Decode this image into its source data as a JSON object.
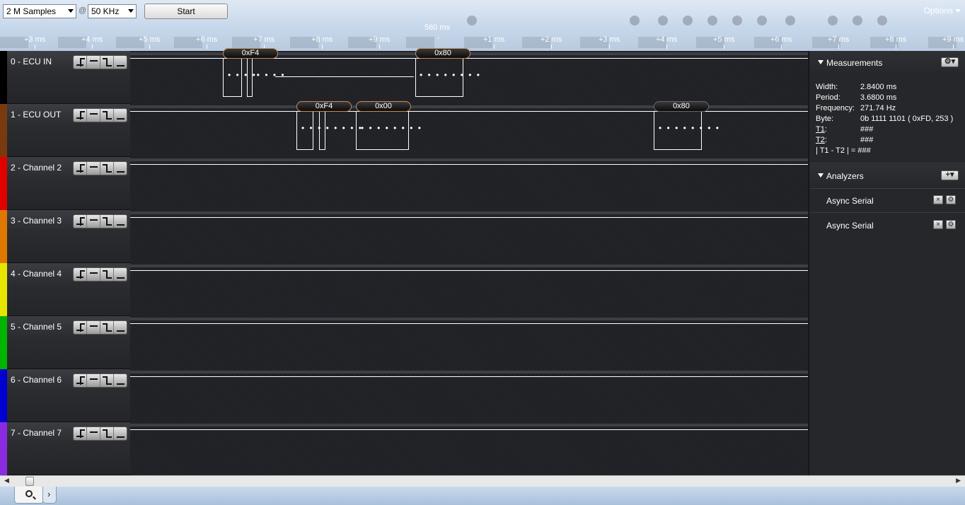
{
  "toolbar": {
    "samples_value": "2 M Samples",
    "at": "@",
    "rate_value": "50 KHz",
    "start_label": "Start",
    "options_label": "Options"
  },
  "timeline": {
    "cursor_time": "560 ms",
    "ticks": [
      "+3 ms",
      "+4 ms",
      "+5 ms",
      "+6 ms",
      "+7 ms",
      "+8 ms",
      "+9 ms",
      "+1 ms",
      "+2 ms",
      "+3 ms",
      "+4 ms",
      "+5 ms",
      "+6 ms",
      "+7 ms",
      "+8 ms",
      "+9 ms"
    ]
  },
  "channels": [
    {
      "name": "0 - ECU IN",
      "color": "#000000"
    },
    {
      "name": "1 - ECU OUT",
      "color": "#7a3a10"
    },
    {
      "name": "2 - Channel 2",
      "color": "#e00000"
    },
    {
      "name": "3 - Channel 3",
      "color": "#e07800"
    },
    {
      "name": "4 - Channel 4",
      "color": "#e6e600"
    },
    {
      "name": "5 - Channel 5",
      "color": "#00b400"
    },
    {
      "name": "6 - Channel 6",
      "color": "#0000d0"
    },
    {
      "name": "7 - Channel 7",
      "color": "#8a2be2"
    }
  ],
  "decoded": {
    "ch0": [
      "0xF4",
      "0x80"
    ],
    "ch1": [
      "0xF4",
      "0x00",
      "0x80"
    ]
  },
  "measurements": {
    "title": "Measurements",
    "width_label": "Width:",
    "width_value": "2.8400 ms",
    "period_label": "Period:",
    "period_value": "3.6800 ms",
    "frequency_label": "Frequency:",
    "frequency_value": "271.74 Hz",
    "byte_label": "Byte:",
    "byte_value": "0b  1111  1101 ( 0xFD, 253 )",
    "t1_label": "T1",
    "t1_value": "###",
    "t2_label": "T2",
    "t2_value": "###",
    "diff_label": "| T1 - T2 | =",
    "diff_value": "###"
  },
  "analyzers": {
    "title": "Analyzers",
    "items": [
      "Async Serial",
      "Async Serial"
    ]
  }
}
